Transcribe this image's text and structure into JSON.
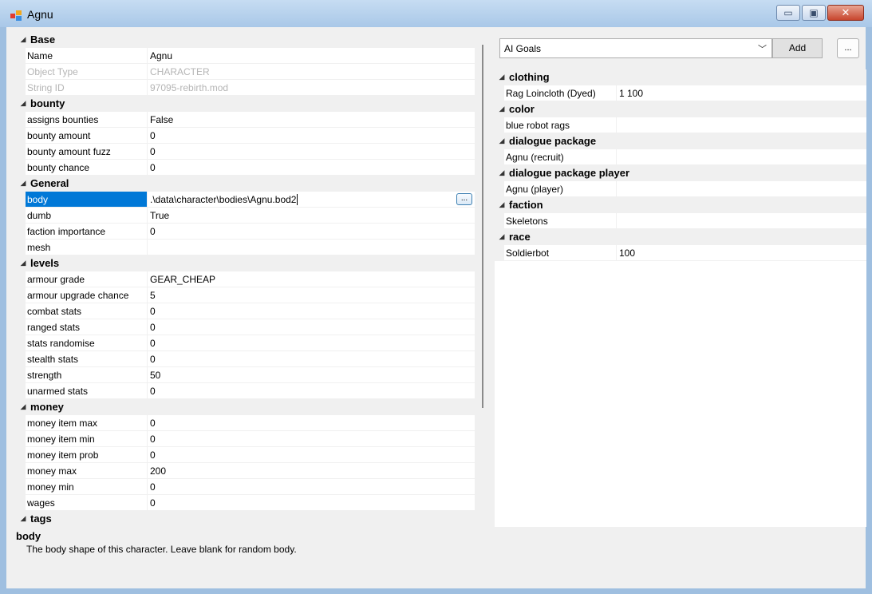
{
  "window": {
    "title": "Agnu",
    "min_glyph": "▭",
    "max_glyph": "▣",
    "close_glyph": "✕"
  },
  "left_grid": {
    "categories": [
      {
        "label": "Base",
        "rows": [
          {
            "name": "Name",
            "value": "Agnu",
            "state": "normal"
          },
          {
            "name": "Object Type",
            "value": "CHARACTER",
            "state": "disabled"
          },
          {
            "name": "String ID",
            "value": "97095-rebirth.mod",
            "state": "disabled"
          }
        ]
      },
      {
        "label": "bounty",
        "rows": [
          {
            "name": "assigns bounties",
            "value": "False"
          },
          {
            "name": "bounty amount",
            "value": "0"
          },
          {
            "name": "bounty amount fuzz",
            "value": "0"
          },
          {
            "name": "bounty chance",
            "value": "0"
          }
        ]
      },
      {
        "label": "General",
        "rows": [
          {
            "name": "body",
            "value": ".\\data\\character\\bodies\\Agnu.bod2",
            "state": "selected"
          },
          {
            "name": "dumb",
            "value": "True"
          },
          {
            "name": "faction importance",
            "value": "0"
          },
          {
            "name": "mesh",
            "value": ""
          }
        ]
      },
      {
        "label": "levels",
        "rows": [
          {
            "name": "armour grade",
            "value": "GEAR_CHEAP"
          },
          {
            "name": "armour upgrade chance",
            "value": "5"
          },
          {
            "name": "combat stats",
            "value": "0"
          },
          {
            "name": "ranged stats",
            "value": "0"
          },
          {
            "name": "stats randomise",
            "value": "0"
          },
          {
            "name": "stealth stats",
            "value": "0"
          },
          {
            "name": "strength",
            "value": "50"
          },
          {
            "name": "unarmed stats",
            "value": "0"
          }
        ]
      },
      {
        "label": "money",
        "rows": [
          {
            "name": "money item max",
            "value": "0"
          },
          {
            "name": "money item min",
            "value": "0"
          },
          {
            "name": "money item prob",
            "value": "0"
          },
          {
            "name": "money max",
            "value": "200"
          },
          {
            "name": "money min",
            "value": "0"
          },
          {
            "name": "wages",
            "value": "0"
          }
        ]
      },
      {
        "label": "tags",
        "rows": []
      }
    ],
    "ellipsis": "..."
  },
  "right_pane": {
    "combo_value": "AI Goals",
    "combo_chevron": "﹀",
    "add_label": "Add",
    "more_label": "...",
    "categories": [
      {
        "label": "clothing",
        "rows": [
          {
            "name": "Rag Loincloth (Dyed)",
            "value": "1    100"
          }
        ]
      },
      {
        "label": "color",
        "rows": [
          {
            "name": "blue robot rags",
            "value": ""
          }
        ]
      },
      {
        "label": "dialogue package",
        "rows": [
          {
            "name": "Agnu (recruit)",
            "value": ""
          }
        ]
      },
      {
        "label": "dialogue package player",
        "rows": [
          {
            "name": "Agnu (player)",
            "value": ""
          }
        ]
      },
      {
        "label": "faction",
        "rows": [
          {
            "name": "Skeletons",
            "value": ""
          }
        ]
      },
      {
        "label": "race",
        "rows": [
          {
            "name": "Soldierbot",
            "value": "100"
          }
        ]
      }
    ]
  },
  "description": {
    "title": "body",
    "text": "The body shape of this character.  Leave blank for random body."
  },
  "caret_glyph": "◢"
}
